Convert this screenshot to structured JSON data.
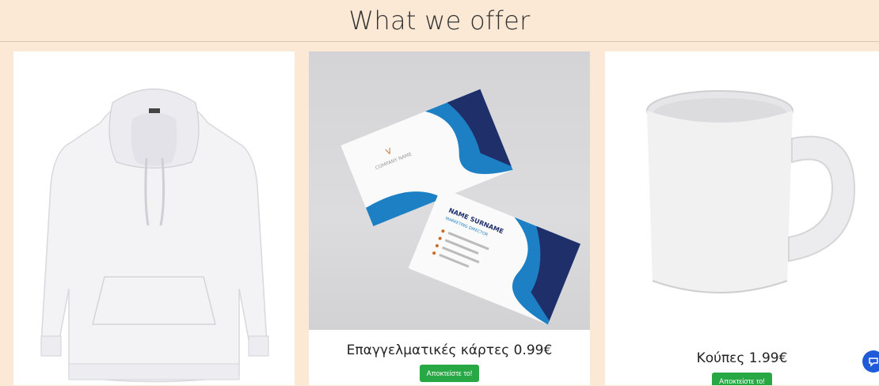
{
  "header": {
    "title": "What we offer"
  },
  "products": [
    {
      "name": "Hoodie",
      "image_label": "hoodie-image"
    },
    {
      "title": "Επαγγελματικές κάρτες 0.99€",
      "button": "Αποκτείστε το!",
      "card_text": {
        "company": "COMPANY NAME",
        "name": "NAME SURNAME",
        "role": "MARKETING DIRECTOR"
      }
    },
    {
      "title": "Κούπες 1.99€",
      "button": "Αποκτείστε το!"
    }
  ],
  "colors": {
    "background": "#fbe9d6",
    "button": "#28a745",
    "chat": "#1f5ad8"
  },
  "chat": {
    "icon": "chat-icon"
  }
}
